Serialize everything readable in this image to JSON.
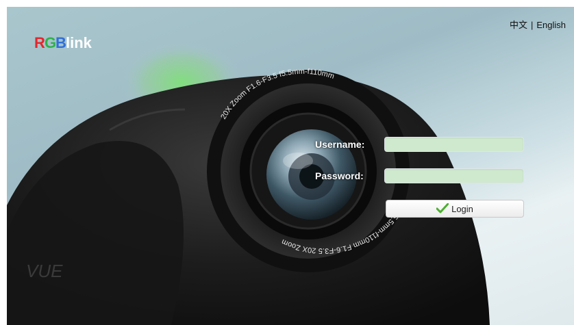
{
  "header": {
    "lang_chinese": "中文",
    "lang_separator": "|",
    "lang_english": "English"
  },
  "logo": {
    "text_r": "R",
    "text_g": "G",
    "text_b": "B",
    "text_link": "link"
  },
  "background": {
    "lens_text_top": "20X Zoom  F1.6-F3.5  f5.5mm-f110mm",
    "lens_text_bottom": "f5.5mm-f110mm  F1.6-F3.5  20X Zoom",
    "product_mark": "VUE"
  },
  "login_form": {
    "username_label": "Username:",
    "username_value": "",
    "password_label": "Password:",
    "password_value": "",
    "login_button_label": "Login"
  },
  "colors": {
    "input_background": "#cfe9cf",
    "check_icon": "#4caf2f",
    "logo_red": "#e4262d",
    "logo_green": "#2fb24a",
    "logo_blue": "#2f6fd8"
  }
}
